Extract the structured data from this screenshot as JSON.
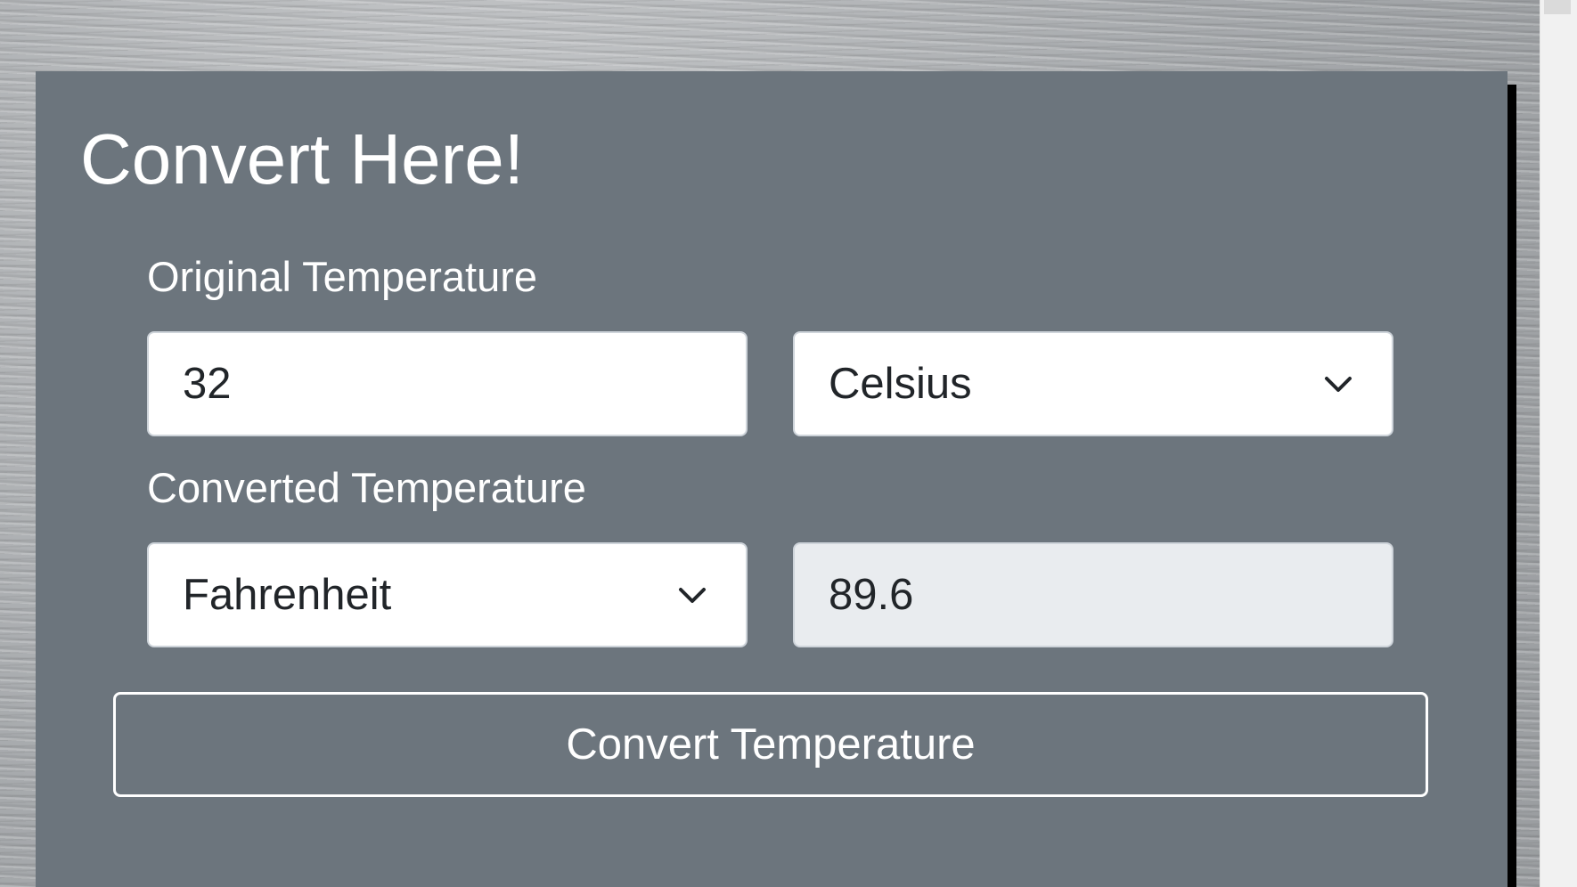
{
  "card": {
    "title": "Convert Here!"
  },
  "original": {
    "label": "Original Temperature",
    "value": "32",
    "unit_selected": "Celsius"
  },
  "converted": {
    "label": "Converted Temperature",
    "unit_selected": "Fahrenheit",
    "value": "89.6"
  },
  "actions": {
    "convert_label": "Convert Temperature"
  },
  "icons": {
    "dropdown": "chevron-down-icon"
  },
  "colors": {
    "card_background": "#6c757d",
    "text_on_card": "#ffffff",
    "input_background": "#ffffff",
    "readonly_background": "#e9ecef",
    "input_text": "#212529",
    "input_border": "#ced4da"
  }
}
